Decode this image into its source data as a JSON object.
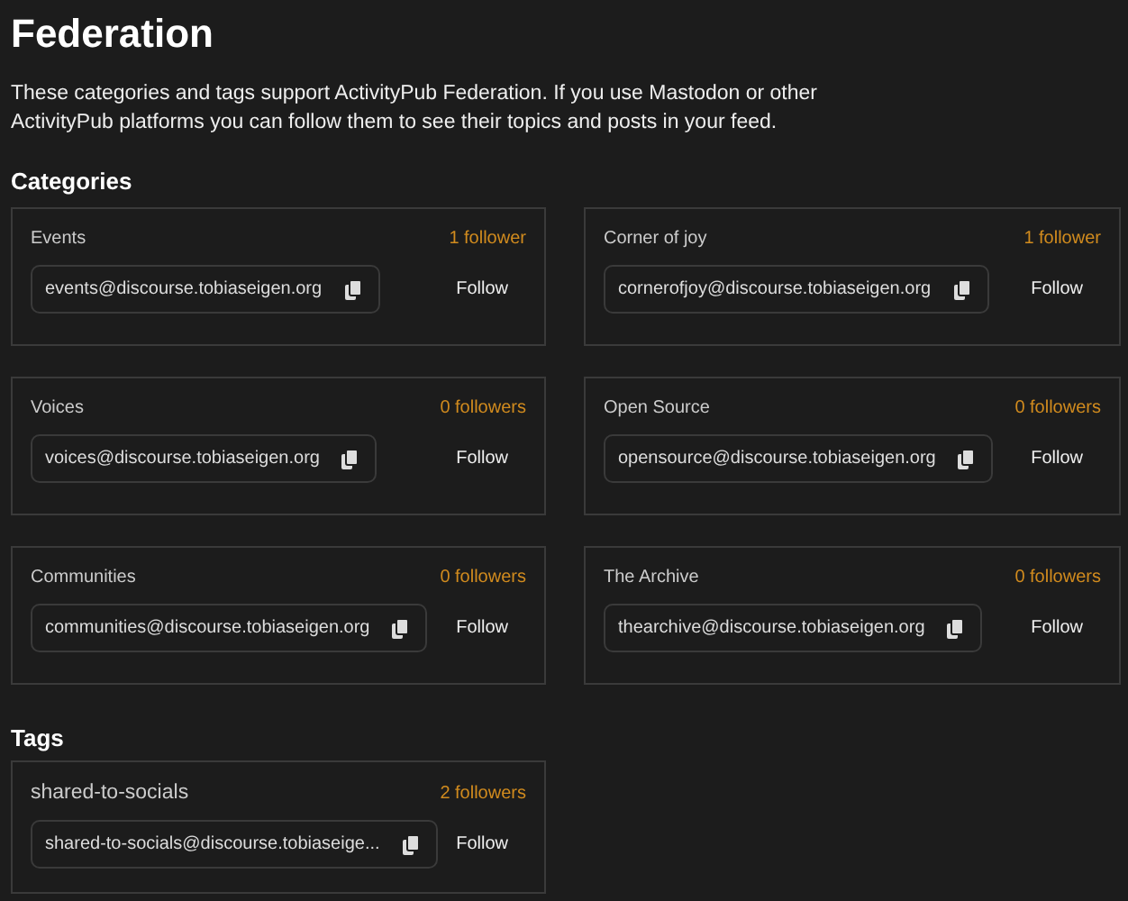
{
  "title": "Federation",
  "description": "These categories and tags support ActivityPub Federation. If you use Mastodon or other ActivityPub platforms you can follow them to see their topics and posts in your feed.",
  "categories": {
    "heading": "Categories",
    "items": [
      {
        "name": "Events",
        "followers": "1 follower",
        "address": "events@discourse.tobiaseigen.org",
        "button": "Follow"
      },
      {
        "name": "Corner of joy",
        "followers": "1 follower",
        "address": "cornerofjoy@discourse.tobiaseigen.org",
        "button": "Follow"
      },
      {
        "name": "Voices",
        "followers": "0 followers",
        "address": "voices@discourse.tobiaseigen.org",
        "button": "Follow"
      },
      {
        "name": "Open Source",
        "followers": "0 followers",
        "address": "opensource@discourse.tobiaseigen.org",
        "button": "Follow"
      },
      {
        "name": "Communities",
        "followers": "0 followers",
        "address": "communities@discourse.tobiaseigen.org",
        "button": "Follow"
      },
      {
        "name": "The Archive",
        "followers": "0 followers",
        "address": "thearchive@discourse.tobiaseigen.org",
        "button": "Follow"
      }
    ]
  },
  "tags": {
    "heading": "Tags",
    "items": [
      {
        "name": "shared-to-socials",
        "followers": "2 followers",
        "address": "shared-to-socials@discourse.tobiaseige...",
        "button": "Follow"
      }
    ]
  }
}
